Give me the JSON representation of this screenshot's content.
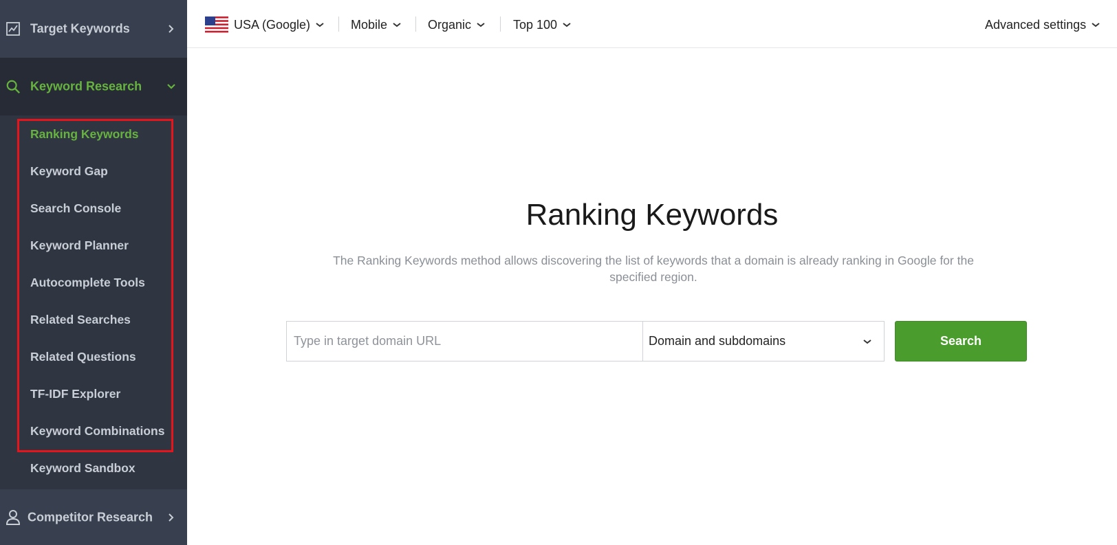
{
  "sidebar": {
    "target_keywords": {
      "label": "Target Keywords",
      "icon": "line-chart-icon"
    },
    "keyword_research": {
      "label": "Keyword Research",
      "icon": "search-icon",
      "items": [
        {
          "label": "Ranking Keywords",
          "active": true
        },
        {
          "label": "Keyword Gap"
        },
        {
          "label": "Search Console"
        },
        {
          "label": "Keyword Planner"
        },
        {
          "label": "Autocomplete Tools"
        },
        {
          "label": "Related Searches"
        },
        {
          "label": "Related Questions"
        },
        {
          "label": "TF-IDF Explorer"
        },
        {
          "label": "Keyword Combinations"
        },
        {
          "label": "Keyword Sandbox"
        }
      ]
    },
    "competitor_research": {
      "label": "Competitor Research",
      "icon": "user-icon"
    }
  },
  "topbar": {
    "region": "USA (Google)",
    "device": "Mobile",
    "result_type": "Organic",
    "depth": "Top 100",
    "advanced_settings": "Advanced settings"
  },
  "main": {
    "title": "Ranking Keywords",
    "description": "The Ranking Keywords method allows discovering the list of keywords that a domain is already ranking in Google for the specified region.",
    "url_input": {
      "placeholder": "Type in target domain URL",
      "value": ""
    },
    "scope_select": {
      "selected": "Domain and subdomains"
    },
    "search_button": "Search"
  },
  "colors": {
    "sidebar_bg": "#2f3541",
    "accent_green": "#67b33f",
    "button_green": "#4a9d2c",
    "highlight_red": "#e8141c"
  }
}
